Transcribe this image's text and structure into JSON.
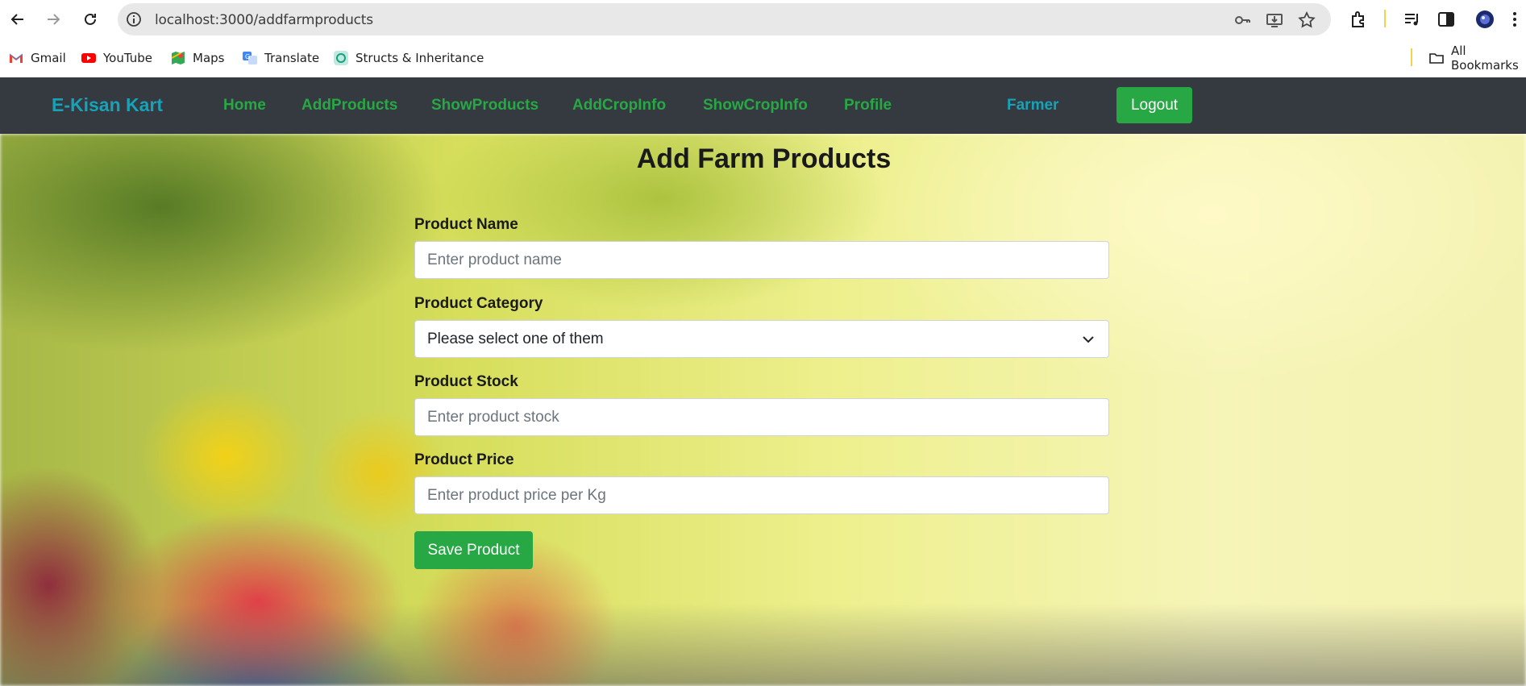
{
  "browser": {
    "url": "localhost:3000/addfarmproducts",
    "bookmarks": [
      "Gmail",
      "YouTube",
      "Maps",
      "Translate",
      "Structs & Inheritance"
    ],
    "all_bookmarks_label": "All Bookmarks"
  },
  "navbar": {
    "brand": "E-Kisan Kart",
    "links": [
      "Home",
      "AddProducts",
      "ShowProducts",
      "AddCropInfo",
      "ShowCropInfo",
      "Profile"
    ],
    "user_role": "Farmer",
    "logout_label": "Logout",
    "colors": {
      "bar": "#343a40",
      "brand": "#17a2b8",
      "link": "#28a745",
      "button": "#28a745"
    }
  },
  "form": {
    "title": "Add Farm Products",
    "fields": [
      {
        "label": "Product Name",
        "placeholder": "Enter product name"
      },
      {
        "label": "Product Category",
        "value": "Please select one of them"
      },
      {
        "label": "Product Stock",
        "placeholder": "Enter product stock"
      },
      {
        "label": "Product Price",
        "placeholder": "Enter product price per Kg"
      }
    ],
    "submit_label": "Save Product"
  }
}
